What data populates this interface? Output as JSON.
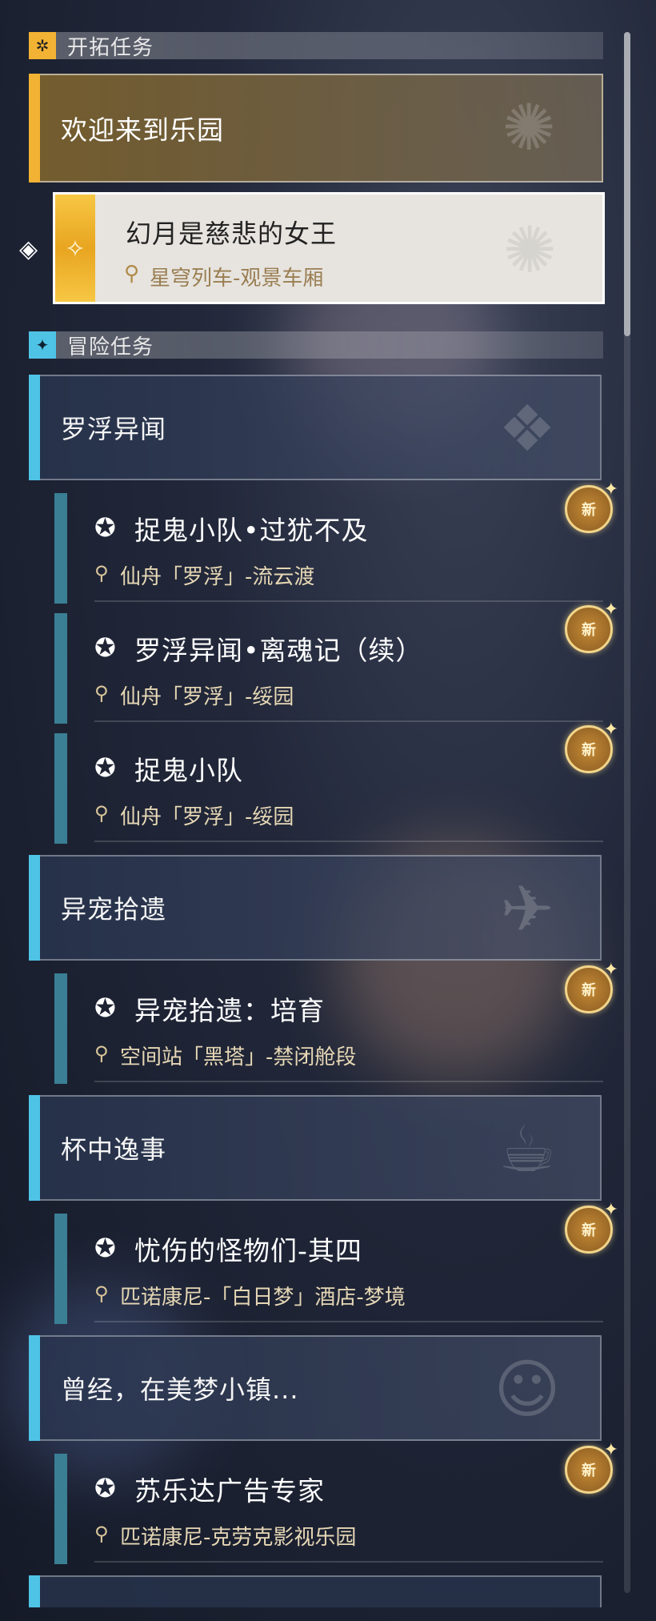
{
  "sections": {
    "trailblaze": {
      "title": "开拓任务",
      "icon": "sparkle-compass-icon",
      "accent": "#f2b233"
    },
    "adventure": {
      "title": "冒险任务",
      "icon": "four-point-star-icon",
      "accent": "#4fc3e6"
    }
  },
  "main_quest": {
    "title": "欢迎来到乐园",
    "sub": {
      "title": "幻月是慈悲的女王",
      "location": "星穹列车-观景车厢"
    }
  },
  "groups": [
    {
      "title": "罗浮异闻"
    },
    {
      "title": "异宠拾遗"
    },
    {
      "title": "杯中逸事"
    },
    {
      "title": "曾经，在美梦小镇..."
    }
  ],
  "quests": [
    {
      "title": "捉鬼小队•过犹不及",
      "location": "仙舟「罗浮」-流云渡",
      "badge": "新"
    },
    {
      "title": "罗浮异闻•离魂记（续）",
      "location": "仙舟「罗浮」-绥园",
      "badge": "新"
    },
    {
      "title": "捉鬼小队",
      "location": "仙舟「罗浮」-绥园",
      "badge": "新"
    },
    {
      "title": "异宠拾遗：培育",
      "location": "空间站「黑塔」-禁闭舱段",
      "badge": "新"
    },
    {
      "title": "忧伤的怪物们-其四",
      "location": "匹诺康尼-「白日梦」酒店-梦境",
      "badge": "新"
    },
    {
      "title": "苏乐达广告专家",
      "location": "匹诺康尼-克劳克影视乐园",
      "badge": "新"
    }
  ],
  "glyphs": {
    "pin": "⬤",
    "quest_icon": "✪"
  },
  "colors": {
    "gold_accent": "#f2b233",
    "blue_accent": "#4fc3e6",
    "quest_bar": "#3a7f94",
    "location_text": "#e6d7b5"
  }
}
